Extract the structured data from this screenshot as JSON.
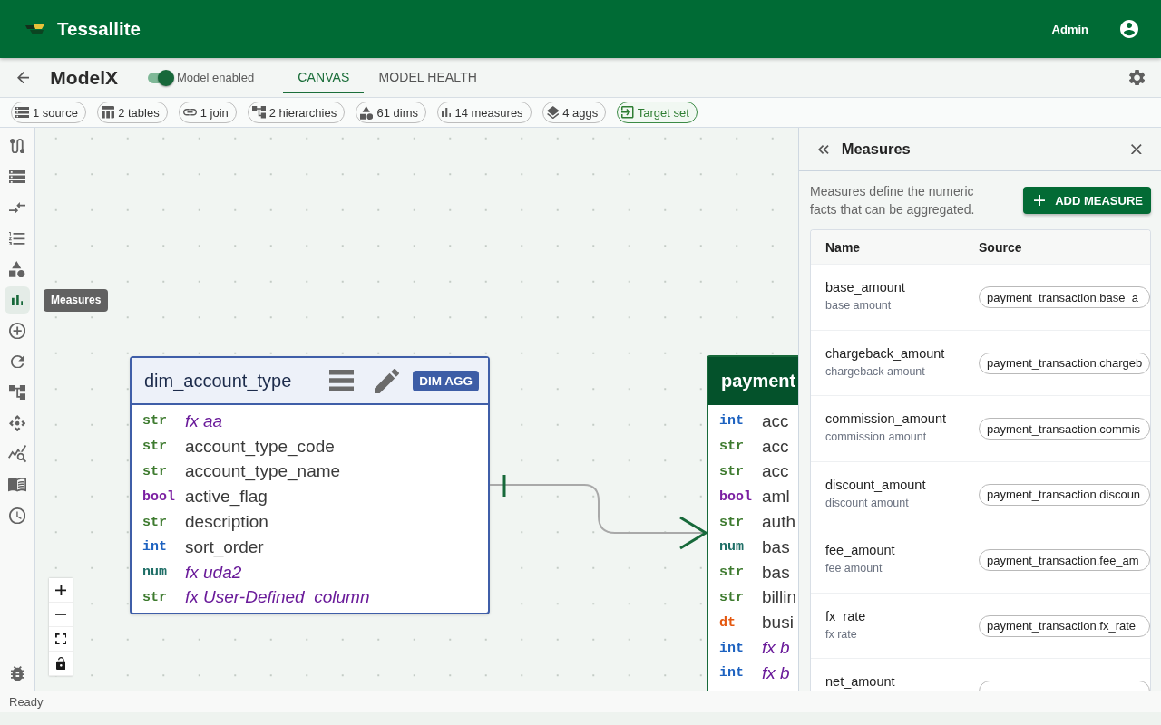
{
  "app": {
    "name": "Tessallite",
    "user": "Admin"
  },
  "model": {
    "title": "ModelX",
    "enabled": true,
    "enabled_label": "Model enabled"
  },
  "tabs": [
    {
      "label": "CANVAS",
      "selected": true
    },
    {
      "label": "MODEL HEALTH",
      "selected": false
    }
  ],
  "summary_chips": [
    {
      "kind": "source",
      "label": "1 source"
    },
    {
      "kind": "tables",
      "label": "2 tables"
    },
    {
      "kind": "join",
      "label": "1 join"
    },
    {
      "kind": "hierarchies",
      "label": "2 hierarchies"
    },
    {
      "kind": "dims",
      "label": "61 dims"
    },
    {
      "kind": "measures",
      "label": "14 measures"
    },
    {
      "kind": "aggs",
      "label": "4 aggs"
    },
    {
      "kind": "target",
      "label": "Target set"
    }
  ],
  "rail": {
    "items": [
      {
        "kind": "route",
        "selected": false
      },
      {
        "kind": "storage",
        "selected": false
      },
      {
        "kind": "arrows",
        "selected": false
      },
      {
        "kind": "list",
        "selected": false
      },
      {
        "kind": "shapes",
        "selected": false
      },
      {
        "kind": "chart",
        "selected": true
      },
      {
        "kind": "add",
        "selected": false
      },
      {
        "kind": "refresh",
        "selected": false
      },
      {
        "kind": "hierarchy",
        "selected": false
      },
      {
        "kind": "move",
        "selected": false
      },
      {
        "kind": "search",
        "selected": false
      },
      {
        "kind": "book",
        "selected": false
      },
      {
        "kind": "clock",
        "selected": false
      }
    ],
    "bottom_items": [
      {
        "kind": "bug",
        "selected": false
      }
    ],
    "tooltip": "Measures"
  },
  "canvas": {
    "nodes": [
      {
        "kind": "dimension",
        "title": "dim_account_type",
        "badge": "DIM AGG",
        "columns": [
          {
            "type": "str",
            "name": "fx aa",
            "calculated": true
          },
          {
            "type": "str",
            "name": "account_type_code",
            "calculated": false
          },
          {
            "type": "str",
            "name": "account_type_name",
            "calculated": false
          },
          {
            "type": "bool",
            "name": "active_flag",
            "calculated": false
          },
          {
            "type": "str",
            "name": "description",
            "calculated": false
          },
          {
            "type": "int",
            "name": "sort_order",
            "calculated": false
          },
          {
            "type": "num",
            "name": "fx uda2",
            "calculated": true
          },
          {
            "type": "str",
            "name": "fx User-Defined_column",
            "calculated": true
          }
        ]
      },
      {
        "kind": "fact",
        "title": "payment",
        "columns": [
          {
            "type": "int",
            "name": "acc",
            "calculated": false
          },
          {
            "type": "str",
            "name": "acc",
            "calculated": false
          },
          {
            "type": "str",
            "name": "acc",
            "calculated": false
          },
          {
            "type": "bool",
            "name": "aml",
            "calculated": false
          },
          {
            "type": "str",
            "name": "auth",
            "calculated": false
          },
          {
            "type": "num",
            "name": "bas",
            "calculated": false
          },
          {
            "type": "str",
            "name": "bas",
            "calculated": false
          },
          {
            "type": "str",
            "name": "billin",
            "calculated": false
          },
          {
            "type": "dt",
            "name": "busi",
            "calculated": false
          },
          {
            "type": "int",
            "name": "fx b",
            "calculated": true
          },
          {
            "type": "int",
            "name": "fx b",
            "calculated": true
          }
        ]
      }
    ],
    "relationships": [
      {
        "kind": "one-to-many"
      }
    ]
  },
  "measures_panel": {
    "title": "Measures",
    "description": "Measures define the numeric facts that can be aggregated.",
    "add_button": "ADD MEASURE",
    "columns": [
      "Name",
      "Source"
    ],
    "rows": [
      {
        "name": "base_amount",
        "label": "base amount",
        "source": "payment_transaction.base_a"
      },
      {
        "name": "chargeback_amount",
        "label": "chargeback amount",
        "source": "payment_transaction.chargeb"
      },
      {
        "name": "commission_amount",
        "label": "commission amount",
        "source": "payment_transaction.commis"
      },
      {
        "name": "discount_amount",
        "label": "discount amount",
        "source": "payment_transaction.discoun"
      },
      {
        "name": "fee_amount",
        "label": "fee amount",
        "source": "payment_transaction.fee_am"
      },
      {
        "name": "fx_rate",
        "label": "fx rate",
        "source": "payment_transaction.fx_rate"
      },
      {
        "name": "net_amount"
      }
    ]
  },
  "status_bar": {
    "text": "Ready"
  }
}
